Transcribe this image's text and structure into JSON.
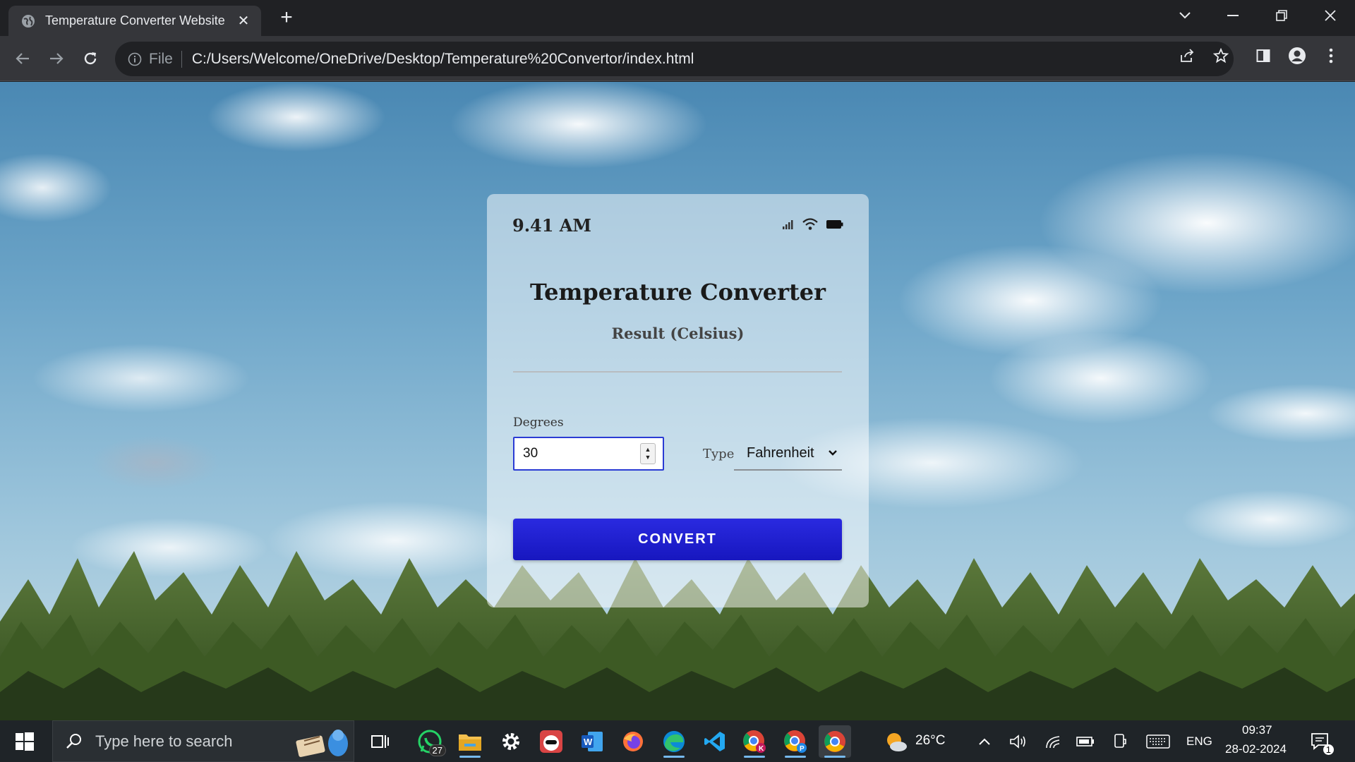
{
  "browser": {
    "tab_title": "Temperature Converter Website",
    "file_label": "File",
    "url": "C:/Users/Welcome/OneDrive/Desktop/Temperature%20Convertor/index.html"
  },
  "card": {
    "status_time": "9.41 AM",
    "title": "Temperature Converter",
    "result_label": "Result (Celsius)",
    "degrees_label": "Degrees",
    "degrees_value": "30",
    "type_label": "Type",
    "type_value": "Fahrenheit",
    "convert_label": "CONVERT",
    "button_color": "#1f1fd6"
  },
  "taskbar": {
    "search_placeholder": "Type here to search",
    "whatsapp_badge": "27",
    "weather": "26°C",
    "language": "ENG",
    "time": "09:37",
    "date": "28-02-2024",
    "notification_count": "1"
  }
}
